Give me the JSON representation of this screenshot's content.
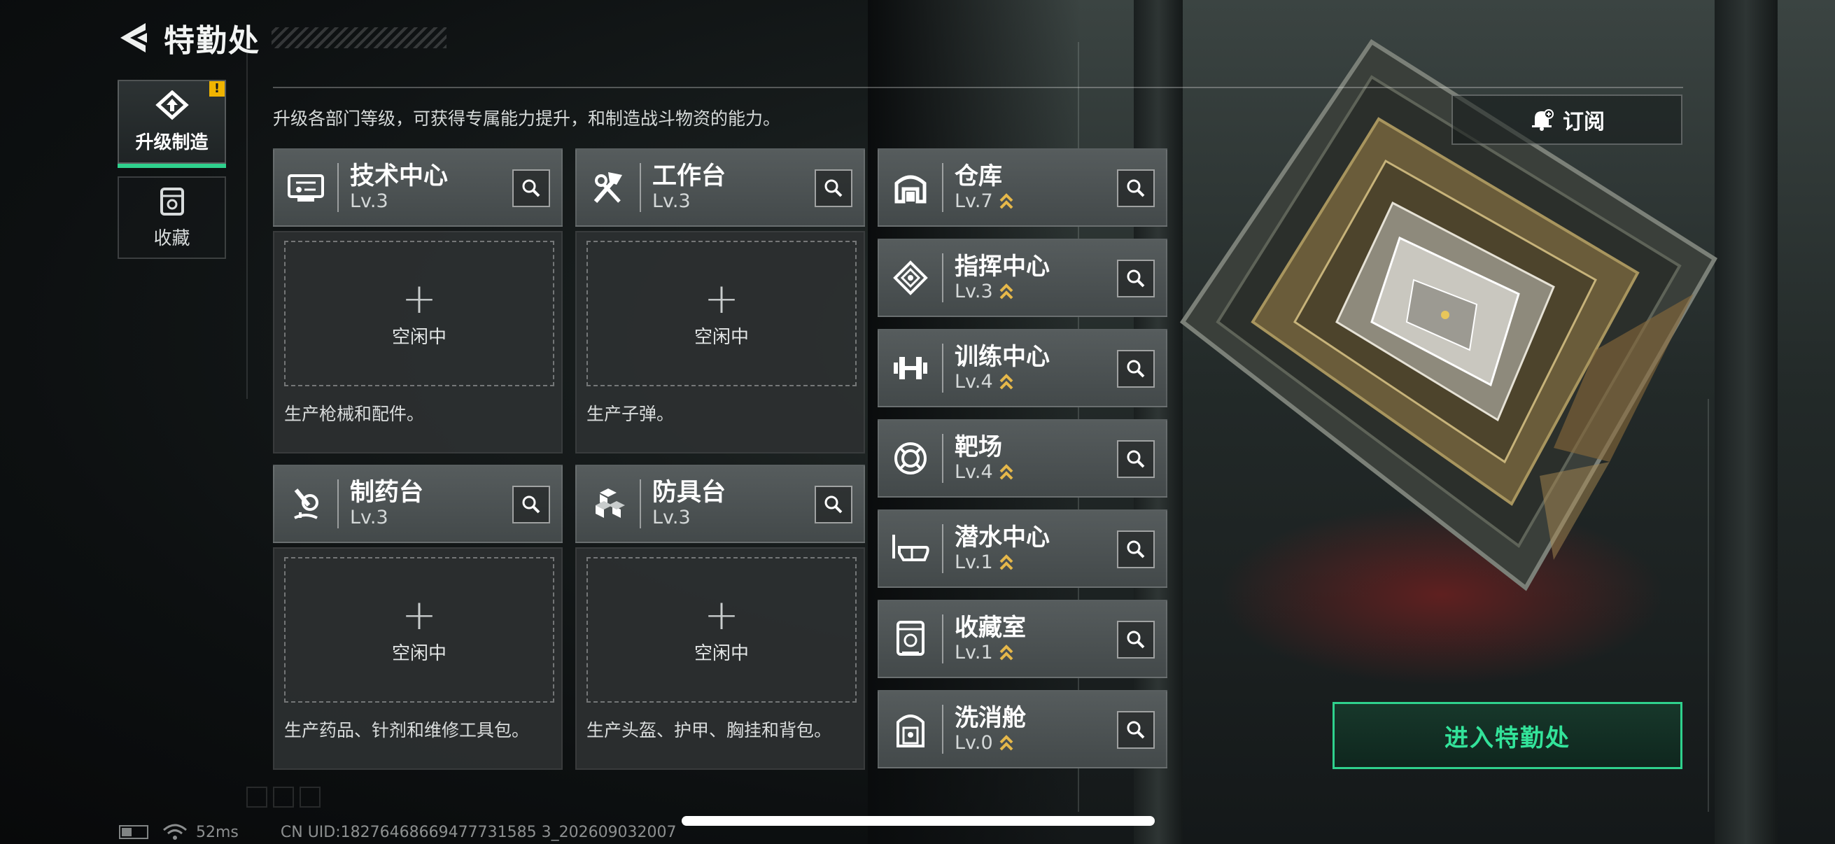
{
  "header": {
    "title": "特勤处"
  },
  "sidebar": {
    "items": [
      {
        "label": "升级制造",
        "icon": "upgrade-icon",
        "active": true,
        "alert": "!"
      },
      {
        "label": "收藏",
        "icon": "collection-icon",
        "active": false
      }
    ]
  },
  "description": "升级各部门等级，可获得专属能力提升，和制造战斗物资的能力。",
  "workstations": [
    {
      "name": "技术中心",
      "level": "Lv.3",
      "icon": "tech-center-icon",
      "slot_label": "空闲中",
      "desc": "生产枪械和配件。"
    },
    {
      "name": "工作台",
      "level": "Lv.3",
      "icon": "workbench-icon",
      "slot_label": "空闲中",
      "desc": "生产子弹。"
    },
    {
      "name": "制药台",
      "level": "Lv.3",
      "icon": "pharmacy-icon",
      "slot_label": "空闲中",
      "desc": "生产药品、针剂和维修工具包。"
    },
    {
      "name": "防具台",
      "level": "Lv.3",
      "icon": "armor-bench-icon",
      "slot_label": "空闲中",
      "desc": "生产头盔、护甲、胸挂和背包。"
    }
  ],
  "facilities": [
    {
      "name": "仓库",
      "level": "Lv.7",
      "icon": "warehouse-icon"
    },
    {
      "name": "指挥中心",
      "level": "Lv.3",
      "icon": "command-center-icon"
    },
    {
      "name": "训练中心",
      "level": "Lv.4",
      "icon": "training-center-icon"
    },
    {
      "name": "靶场",
      "level": "Lv.4",
      "icon": "shooting-range-icon"
    },
    {
      "name": "潜水中心",
      "level": "Lv.1",
      "icon": "diving-center-icon"
    },
    {
      "name": "收藏室",
      "level": "Lv.1",
      "icon": "collection-room-icon"
    },
    {
      "name": "洗消舱",
      "level": "Lv.0",
      "icon": "decontamination-icon"
    }
  ],
  "buttons": {
    "subscribe": "订阅",
    "enter": "进入特勤处"
  },
  "status": {
    "ping": "52ms",
    "uid": "CN UID:18276468669477731585 3_202609032007"
  },
  "colors": {
    "accent": "#2fd18d",
    "upgrade_chevron": "#e6b84a",
    "alert": "#f0b400"
  }
}
